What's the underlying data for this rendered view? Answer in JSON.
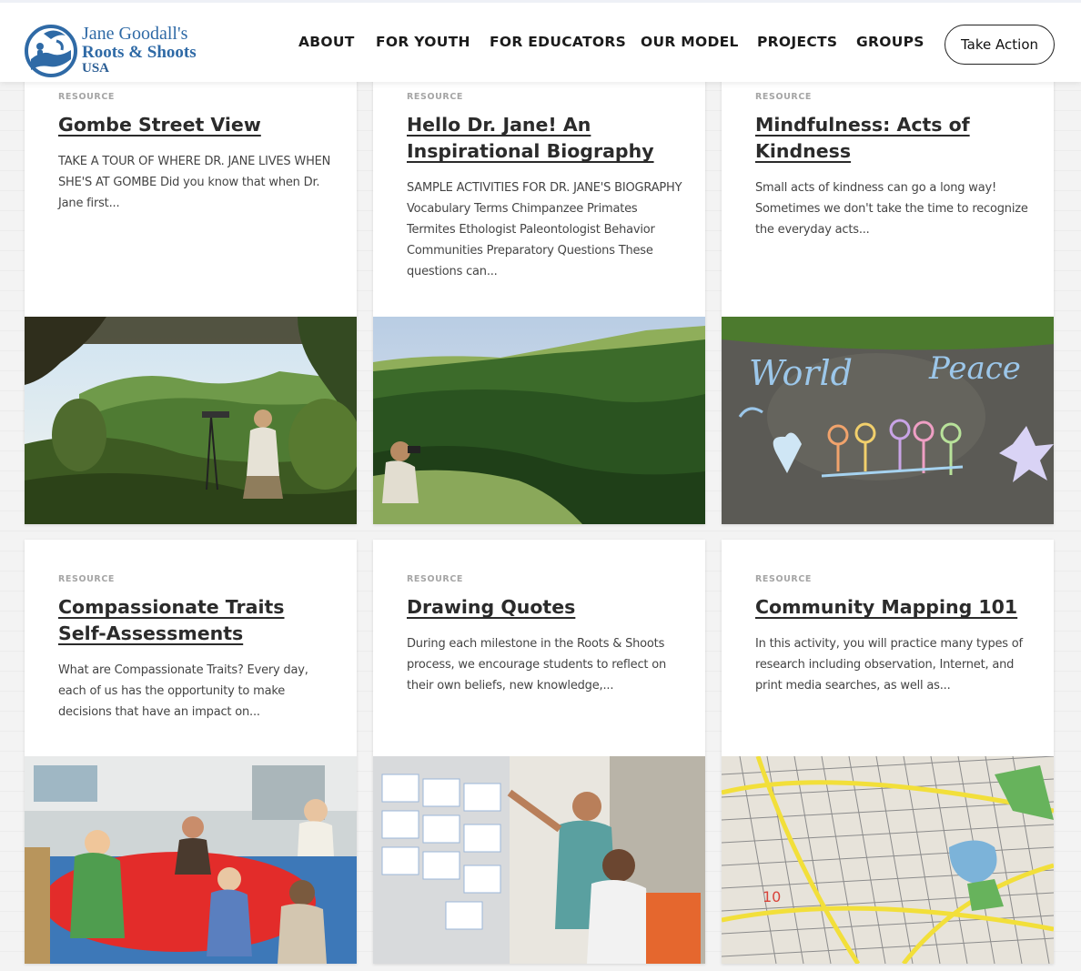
{
  "header": {
    "logo": {
      "line1": "Jane Goodall's",
      "line2": "Roots & Shoots",
      "line3": "USA"
    },
    "nav": [
      "ABOUT",
      "FOR YOUTH",
      "FOR EDUCATORS",
      "OUR MODEL",
      "PROJECTS",
      "GROUPS"
    ],
    "cta_label": "Take Action"
  },
  "cards": [
    {
      "label": "RESOURCE",
      "title": "Gombe Street View",
      "excerpt": "TAKE A TOUR OF WHERE DR. JANE LIVES WHEN SHE'S AT GOMBE Did you know that when Dr. Jane first...",
      "image": "forest-valley-photo"
    },
    {
      "label": "RESOURCE",
      "title": "Hello Dr. Jane! An Inspirational Biography",
      "excerpt": "SAMPLE ACTIVITIES FOR DR. JANE'S BIOGRAPHY Vocabulary Terms Chimpanzee Primates Termites Ethologist Paleontologist Behavior Communities Preparatory Questions These questions can...",
      "image": "hillside-binoculars-photo"
    },
    {
      "label": "RESOURCE",
      "title": "Mindfulness: Acts of Kindness",
      "excerpt": "Small acts of kindness can go a long way! Sometimes we don't take the time to recognize the everyday acts...",
      "image": "chalk-world-peace-photo",
      "image_text": [
        "World",
        "Peace"
      ]
    },
    {
      "label": "RESOURCE",
      "title": "Compassionate Traits Self-Assessments",
      "excerpt": "What are Compassionate Traits? Every day, each of us has the opportunity to make decisions that have an impact on...",
      "image": "classroom-circle-photo"
    },
    {
      "label": "RESOURCE",
      "title": "Drawing Quotes",
      "excerpt": "During each milestone in the Roots & Shoots process, we encourage students to reflect on their own beliefs, new knowledge,...",
      "image": "students-drawings-wall-photo"
    },
    {
      "label": "RESOURCE",
      "title": "Community Mapping 101",
      "excerpt": "In this activity, you will practice many types of research including observation, Internet, and print media searches, as well as...",
      "image": "street-map-photo"
    }
  ],
  "colors": {
    "brand_blue": "#2f6aa6",
    "text_dark": "#2b2b2b",
    "label_gray": "#a5a5a5"
  }
}
